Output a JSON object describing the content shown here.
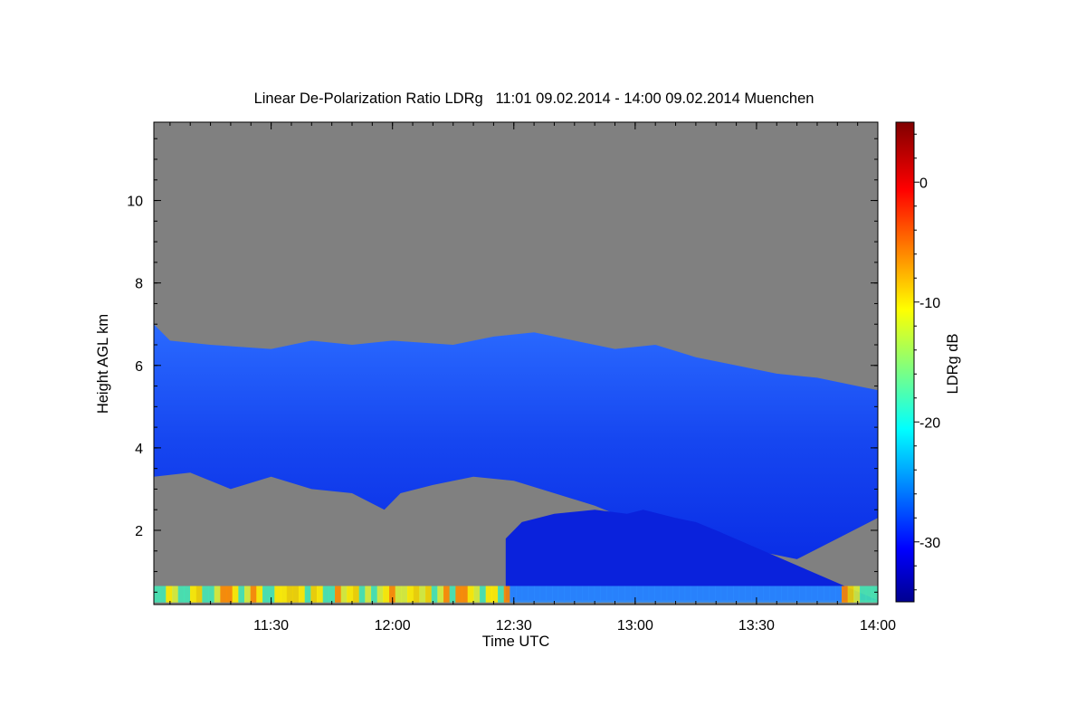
{
  "chart_data": {
    "type": "heatmap",
    "title": "Linear De-Polarization Ratio LDRg   11:01 09.02.2014 - 14:00 09.02.2014 Muenchen",
    "xlabel": "Time UTC",
    "ylabel": "Height AGL km",
    "colorbar_label": "LDRg dB",
    "x_range_minutes_utc": [
      661,
      840
    ],
    "y_range_km": [
      0.2,
      11.9
    ],
    "x_ticks": [
      {
        "value": 690,
        "label": "11:30"
      },
      {
        "value": 720,
        "label": "12:00"
      },
      {
        "value": 750,
        "label": "12:30"
      },
      {
        "value": 780,
        "label": "13:00"
      },
      {
        "value": 810,
        "label": "13:30"
      },
      {
        "value": 840,
        "label": "14:00"
      }
    ],
    "y_ticks": [
      {
        "value": 2,
        "label": "2"
      },
      {
        "value": 4,
        "label": "4"
      },
      {
        "value": 6,
        "label": "6"
      },
      {
        "value": 8,
        "label": "8"
      },
      {
        "value": 10,
        "label": "10"
      }
    ],
    "colorbar_range_db": [
      -35,
      5
    ],
    "colorbar_ticks": [
      {
        "value": 0,
        "label": "0"
      },
      {
        "value": -10,
        "label": "-10"
      },
      {
        "value": -20,
        "label": "-20"
      },
      {
        "value": -30,
        "label": "-30"
      }
    ],
    "background_color": "#808080",
    "cloud_layer": {
      "ldr_db_typical": -29,
      "top_km": [
        [
          661,
          7.0
        ],
        [
          665,
          6.6
        ],
        [
          675,
          6.5
        ],
        [
          690,
          6.4
        ],
        [
          700,
          6.6
        ],
        [
          710,
          6.5
        ],
        [
          720,
          6.6
        ],
        [
          735,
          6.5
        ],
        [
          745,
          6.7
        ],
        [
          755,
          6.8
        ],
        [
          765,
          6.6
        ],
        [
          775,
          6.4
        ],
        [
          785,
          6.5
        ],
        [
          795,
          6.2
        ],
        [
          805,
          6.0
        ],
        [
          815,
          5.8
        ],
        [
          825,
          5.7
        ],
        [
          835,
          5.5
        ],
        [
          840,
          5.4
        ]
      ],
      "base_km": [
        [
          661,
          3.3
        ],
        [
          670,
          3.4
        ],
        [
          680,
          3.0
        ],
        [
          690,
          3.3
        ],
        [
          700,
          3.0
        ],
        [
          710,
          2.9
        ],
        [
          718,
          2.5
        ],
        [
          722,
          2.9
        ],
        [
          730,
          3.1
        ],
        [
          740,
          3.3
        ],
        [
          750,
          3.2
        ],
        [
          760,
          2.9
        ],
        [
          770,
          2.6
        ],
        [
          780,
          2.2
        ],
        [
          790,
          2.0
        ],
        [
          800,
          1.7
        ],
        [
          810,
          1.5
        ],
        [
          820,
          1.3
        ],
        [
          830,
          1.8
        ],
        [
          840,
          2.3
        ]
      ]
    },
    "lower_layer": {
      "ldr_db_typical": -31,
      "start_minute": 748,
      "top_km": [
        [
          748,
          1.8
        ],
        [
          752,
          2.2
        ],
        [
          760,
          2.4
        ],
        [
          770,
          2.5
        ],
        [
          778,
          2.4
        ],
        [
          782,
          2.5
        ],
        [
          790,
          2.3
        ],
        [
          795,
          2.2
        ],
        [
          800,
          2.0
        ]
      ],
      "base_km": 0.3
    },
    "near_ground_layer": {
      "height_km": [
        0.25,
        0.65
      ],
      "ldr_db_range": [
        -20,
        -5
      ]
    }
  }
}
